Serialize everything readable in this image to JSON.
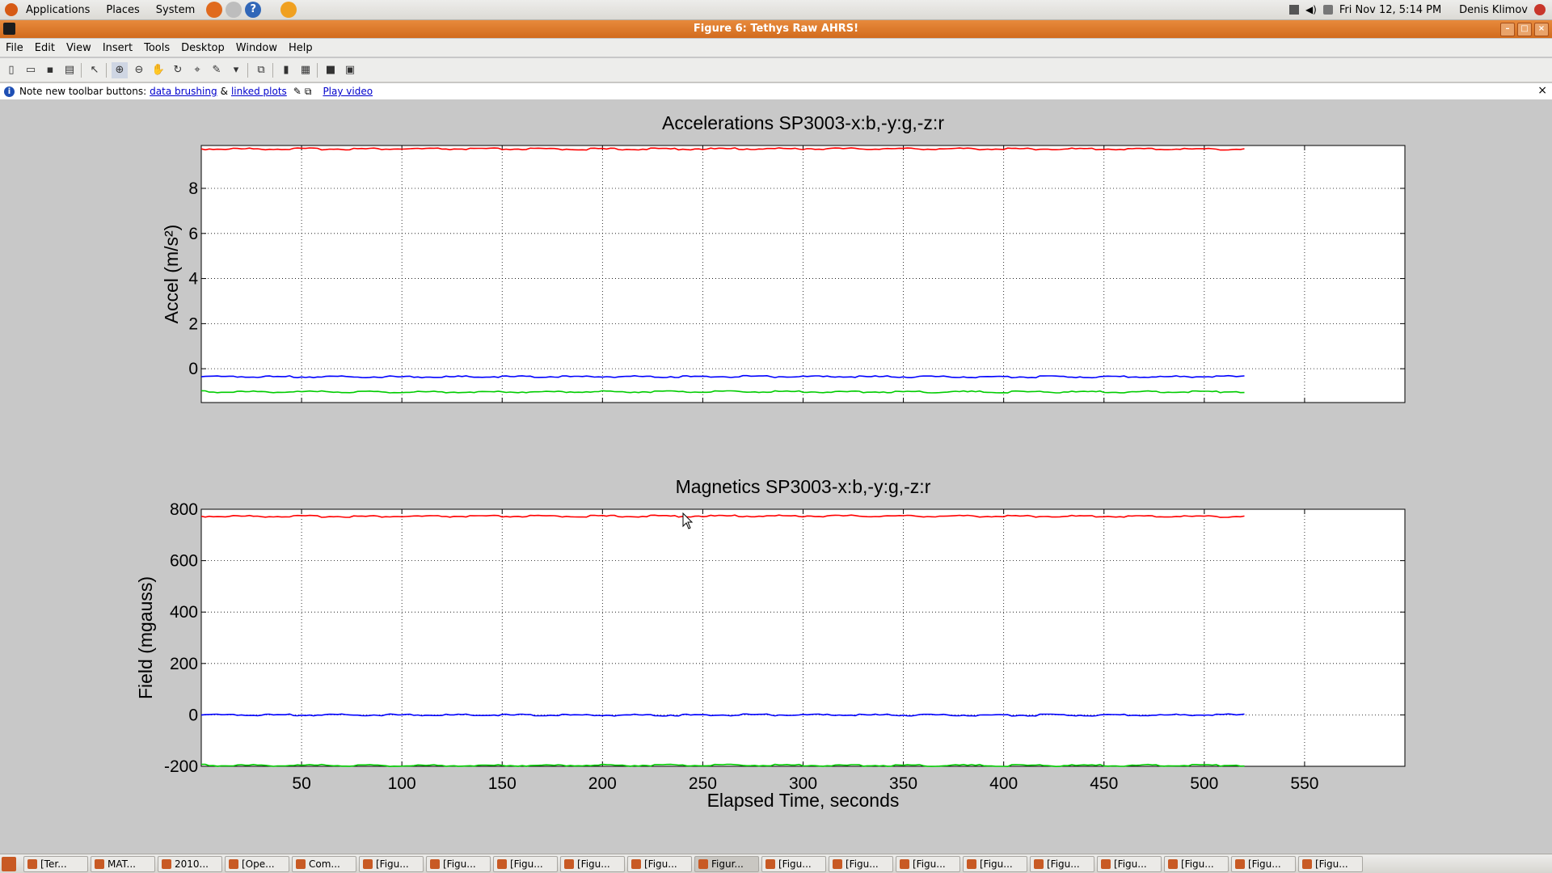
{
  "top_panel": {
    "menus": [
      "Applications",
      "Places",
      "System"
    ],
    "clock": "Fri Nov 12,  5:14 PM",
    "user": "Denis Klimov"
  },
  "window": {
    "title": "Figure 6: Tethys Raw AHRS!",
    "menus": [
      "File",
      "Edit",
      "View",
      "Insert",
      "Tools",
      "Desktop",
      "Window",
      "Help"
    ]
  },
  "notice": {
    "text": "Note new toolbar buttons:",
    "link1": "data brushing",
    "amp": "&",
    "link2": "linked plots",
    "link3": "Play video",
    "close": "×"
  },
  "chart_data": [
    {
      "type": "line",
      "title": "Accelerations SP3003-x:b,-y:g,-z:r",
      "xlabel": "",
      "ylabel": "Accel (m/s²)",
      "xlim": [
        0,
        600
      ],
      "ylim": [
        -1.5,
        9.9
      ],
      "yticks": [
        0,
        2,
        4,
        6,
        8
      ],
      "xticks": [
        50,
        100,
        150,
        200,
        250,
        300,
        350,
        400,
        450,
        500,
        550
      ],
      "grid": true,
      "series": [
        {
          "color": "#ff0000",
          "x": [
            0,
            100,
            200,
            300,
            400,
            520
          ],
          "y": [
            9.75,
            9.75,
            9.74,
            9.76,
            9.75,
            9.74
          ]
        },
        {
          "color": "#0000ff",
          "x": [
            0,
            100,
            200,
            300,
            400,
            520
          ],
          "y": [
            -0.35,
            -0.36,
            -0.35,
            -0.35,
            -0.36,
            -0.35
          ]
        },
        {
          "color": "#00cc00",
          "x": [
            0,
            100,
            200,
            300,
            400,
            520
          ],
          "y": [
            -1.02,
            -1.03,
            -1.02,
            -1.02,
            -1.03,
            -1.02
          ]
        }
      ]
    },
    {
      "type": "line",
      "title": "Magnetics SP3003-x:b,-y:g,-z:r",
      "xlabel": "Elapsed Time,  seconds",
      "ylabel": "Field (mgauss)",
      "xlim": [
        0,
        600
      ],
      "ylim": [
        -200,
        800
      ],
      "yticks": [
        -200,
        0,
        200,
        400,
        600,
        800
      ],
      "xticks": [
        50,
        100,
        150,
        200,
        250,
        300,
        350,
        400,
        450,
        500,
        550
      ],
      "grid": true,
      "series": [
        {
          "color": "#ff0000",
          "x": [
            0,
            100,
            200,
            300,
            400,
            520
          ],
          "y": [
            773,
            772,
            773,
            774,
            773,
            772
          ]
        },
        {
          "color": "#0000ff",
          "x": [
            0,
            100,
            200,
            300,
            400,
            520
          ],
          "y": [
            0,
            0,
            -1,
            0,
            -1,
            0
          ]
        },
        {
          "color": "#00cc00",
          "x": [
            0,
            100,
            200,
            300,
            400,
            520
          ],
          "y": [
            -196,
            -197,
            -196,
            -196,
            -197,
            -196
          ]
        }
      ]
    }
  ],
  "taskbar": {
    "items": [
      "[Ter...",
      "MAT...",
      "2010...",
      "[Ope...",
      "Com...",
      "[Figu...",
      "[Figu...",
      "[Figu...",
      "[Figu...",
      "[Figu...",
      "Figur...",
      "[Figu...",
      "[Figu...",
      "[Figu...",
      "[Figu...",
      "[Figu...",
      "[Figu...",
      "[Figu...",
      "[Figu...",
      "[Figu..."
    ],
    "active_index": 10
  }
}
